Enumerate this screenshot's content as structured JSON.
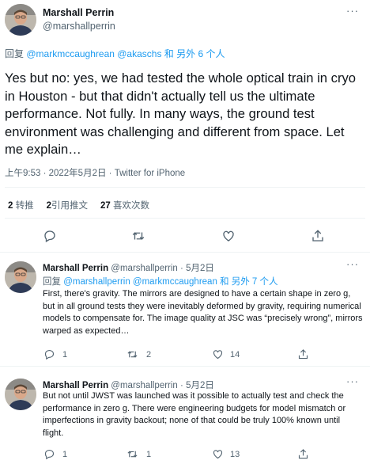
{
  "main_tweet": {
    "author_name": "Marshall Perrin",
    "author_handle": "@marshallperrin",
    "reply_prefix": "回复",
    "reply_to": "@markmccaughrean @akaschs",
    "reply_suffix": "和 另外 6 个人",
    "text": "Yes but no: yes, we had tested the whole optical train in cryo in Houston - but that didn't actually tell us the ultimate performance. Not fully. In many ways, the ground test environment was challenging and different from space. Let me explain…",
    "timestamp": "上午9:53 · 2022年5月2日 · Twitter for iPhone",
    "stats": {
      "retweets_count": "2",
      "retweets_label": "转推",
      "quotes_count": "2",
      "quotes_label": "引用推文",
      "likes_count": "27",
      "likes_label": "喜欢次数"
    },
    "actions": [
      "reply-icon",
      "retweet-icon",
      "like-icon",
      "share-icon"
    ]
  },
  "replies": [
    {
      "author_name": "Marshall Perrin",
      "author_handle": "@marshallperrin",
      "date": "5月2日",
      "separator": "·",
      "reply_prefix": "回复",
      "reply_to": "@marshallperrin @markmccaughrean",
      "reply_suffix": "和 另外 7 个人",
      "text": "First, there's gravity. The mirrors are designed to have a certain shape in zero g, but in all ground tests they were inevitably deformed by gravity, requiring numerical models to compensate for. The image quality at JSC was “precisely wrong”, mirrors warped as expected…",
      "reply_count": "1",
      "retweet_count": "2",
      "like_count": "14"
    },
    {
      "author_name": "Marshall Perrin",
      "author_handle": "@marshallperrin",
      "date": "5月2日",
      "separator": "·",
      "text": "But not until JWST was launched was it possible to actually test and check the performance in zero g. There were engineering budgets for model mismatch or imperfections in gravity backout; none of that could be truly 100% known until flight.",
      "reply_count": "1",
      "retweet_count": "1",
      "like_count": "13"
    }
  ],
  "more_label": "···",
  "colors": {
    "link": "#1d9bf0",
    "muted": "#536471",
    "text": "#0f1419",
    "divider": "#eff3f4"
  }
}
